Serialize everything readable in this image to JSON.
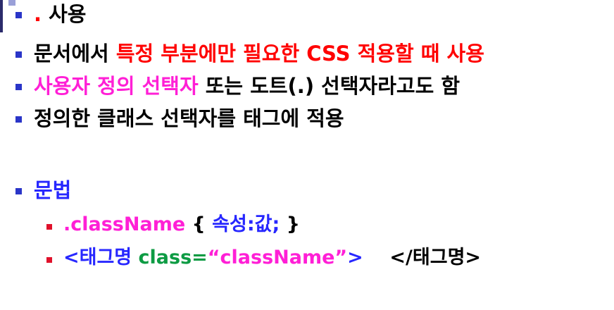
{
  "bullets": [
    {
      "dot": ".",
      "text": " 사용"
    },
    {
      "prefix": "문서에서 ",
      "highlight": "특정 부분에만 필요한 CSS 적용할 때 사용"
    },
    {
      "highlight": "사용자 정의 선택자",
      "suffix": " 또는 도트(.) 선택자라고도 함"
    },
    {
      "text": "정의한 클래스 선택자를 태그에 적용"
    },
    {
      "text": "문법"
    }
  ],
  "syntax": {
    "line1": {
      "selector": ".className",
      "open": " { ",
      "declaration": "속성:값;",
      "close": " }"
    },
    "line2": {
      "open_tag": "<태그명 ",
      "attr_name": "class=",
      "attr_value": "“className”",
      "tag_end": ">",
      "spacer": "    ",
      "close_tag": "</태그명>"
    }
  },
  "colors": {
    "bullet": "#2a35c8",
    "sub_bullet": "#e0112b",
    "highlight_red": "#ff0000",
    "highlight_magenta": "#ff1fd6",
    "keyword_blue": "#2727ff",
    "attr_green": "#0d9b43"
  }
}
